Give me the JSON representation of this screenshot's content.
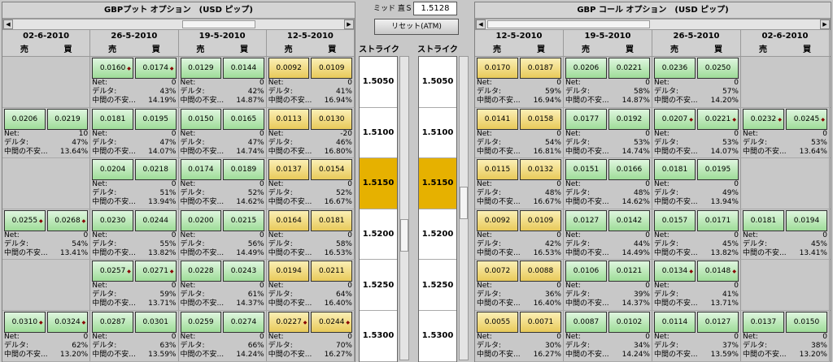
{
  "put": {
    "title": "GBPプット オプション　(USD ピップ)",
    "dates": [
      "02-6-2010",
      "26-5-2010",
      "19-5-2010",
      "12-5-2010"
    ],
    "headers": {
      "sell": "売",
      "buy": "買"
    },
    "rows": [
      [
        null,
        {
          "bid": "0.0160",
          "ask": "0.0174",
          "net": "0",
          "delta": "43%",
          "iv": "14.19%",
          "color": "green",
          "marks": true
        },
        {
          "bid": "0.0129",
          "ask": "0.0144",
          "net": "0",
          "delta": "42%",
          "iv": "14.87%",
          "color": "green"
        },
        {
          "bid": "0.0092",
          "ask": "0.0109",
          "net": "0",
          "delta": "41%",
          "iv": "16.94%",
          "color": "yellow"
        }
      ],
      [
        {
          "bid": "0.0206",
          "ask": "0.0219",
          "net": "10",
          "delta": "47%",
          "iv": "13.64%",
          "color": "green"
        },
        {
          "bid": "0.0181",
          "ask": "0.0195",
          "net": "0",
          "delta": "47%",
          "iv": "14.07%",
          "color": "green"
        },
        {
          "bid": "0.0150",
          "ask": "0.0165",
          "net": "0",
          "delta": "47%",
          "iv": "14.74%",
          "color": "green"
        },
        {
          "bid": "0.0113",
          "ask": "0.0130",
          "net": "-20",
          "delta": "46%",
          "iv": "16.80%",
          "color": "yellow"
        }
      ],
      [
        null,
        {
          "bid": "0.0204",
          "ask": "0.0218",
          "net": "0",
          "delta": "51%",
          "iv": "13.94%",
          "color": "green"
        },
        {
          "bid": "0.0174",
          "ask": "0.0189",
          "net": "0",
          "delta": "52%",
          "iv": "14.62%",
          "color": "green"
        },
        {
          "bid": "0.0137",
          "ask": "0.0154",
          "net": "0",
          "delta": "52%",
          "iv": "16.67%",
          "color": "yellow"
        }
      ],
      [
        {
          "bid": "0.0255",
          "ask": "0.0268",
          "net": "0",
          "delta": "54%",
          "iv": "13.41%",
          "color": "green",
          "marks": true
        },
        {
          "bid": "0.0230",
          "ask": "0.0244",
          "net": "0",
          "delta": "55%",
          "iv": "13.82%",
          "color": "green"
        },
        {
          "bid": "0.0200",
          "ask": "0.0215",
          "net": "0",
          "delta": "56%",
          "iv": "14.49%",
          "color": "green"
        },
        {
          "bid": "0.0164",
          "ask": "0.0181",
          "net": "0",
          "delta": "58%",
          "iv": "16.53%",
          "color": "yellow"
        }
      ],
      [
        null,
        {
          "bid": "0.0257",
          "ask": "0.0271",
          "net": "0",
          "delta": "59%",
          "iv": "13.71%",
          "color": "green",
          "marks": true
        },
        {
          "bid": "0.0228",
          "ask": "0.0243",
          "net": "0",
          "delta": "61%",
          "iv": "14.37%",
          "color": "green"
        },
        {
          "bid": "0.0194",
          "ask": "0.0211",
          "net": "0",
          "delta": "64%",
          "iv": "16.40%",
          "color": "yellow"
        }
      ],
      [
        {
          "bid": "0.0310",
          "ask": "0.0324",
          "net": "0",
          "delta": "62%",
          "iv": "13.20%",
          "color": "green",
          "marks": true
        },
        {
          "bid": "0.0287",
          "ask": "0.0301",
          "net": "0",
          "delta": "63%",
          "iv": "13.59%",
          "color": "green"
        },
        {
          "bid": "0.0259",
          "ask": "0.0274",
          "net": "0",
          "delta": "66%",
          "iv": "14.24%",
          "color": "green"
        },
        {
          "bid": "0.0227",
          "ask": "0.0244",
          "net": "0",
          "delta": "70%",
          "iv": "16.27%",
          "color": "yellow",
          "marks": true
        }
      ]
    ]
  },
  "call": {
    "title": "GBP コール オプション　(USD ピップ)",
    "dates": [
      "12-5-2010",
      "19-5-2010",
      "26-5-2010",
      "02-6-2010"
    ],
    "rows": [
      [
        {
          "bid": "0.0170",
          "ask": "0.0187",
          "net": "0",
          "delta": "59%",
          "iv": "16.94%",
          "color": "yellow"
        },
        {
          "bid": "0.0206",
          "ask": "0.0221",
          "net": "0",
          "delta": "58%",
          "iv": "14.87%",
          "color": "green"
        },
        {
          "bid": "0.0236",
          "ask": "0.0250",
          "net": "0",
          "delta": "57%",
          "iv": "14.20%",
          "color": "green"
        },
        null
      ],
      [
        {
          "bid": "0.0141",
          "ask": "0.0158",
          "net": "0",
          "delta": "54%",
          "iv": "16.81%",
          "color": "yellow"
        },
        {
          "bid": "0.0177",
          "ask": "0.0192",
          "net": "0",
          "delta": "53%",
          "iv": "14.74%",
          "color": "green"
        },
        {
          "bid": "0.0207",
          "ask": "0.0221",
          "net": "0",
          "delta": "53%",
          "iv": "14.07%",
          "color": "green",
          "marks": true
        },
        {
          "bid": "0.0232",
          "ask": "0.0245",
          "net": "0",
          "delta": "53%",
          "iv": "13.64%",
          "color": "green",
          "marks": true
        }
      ],
      [
        {
          "bid": "0.0115",
          "ask": "0.0132",
          "net": "0",
          "delta": "48%",
          "iv": "16.67%",
          "color": "yellow"
        },
        {
          "bid": "0.0151",
          "ask": "0.0166",
          "net": "0",
          "delta": "48%",
          "iv": "14.62%",
          "color": "green"
        },
        {
          "bid": "0.0181",
          "ask": "0.0195",
          "net": "0",
          "delta": "49%",
          "iv": "13.94%",
          "color": "green"
        },
        null
      ],
      [
        {
          "bid": "0.0092",
          "ask": "0.0109",
          "net": "0",
          "delta": "42%",
          "iv": "16.53%",
          "color": "yellow"
        },
        {
          "bid": "0.0127",
          "ask": "0.0142",
          "net": "0",
          "delta": "44%",
          "iv": "14.49%",
          "color": "green"
        },
        {
          "bid": "0.0157",
          "ask": "0.0171",
          "net": "0",
          "delta": "45%",
          "iv": "13.82%",
          "color": "green"
        },
        {
          "bid": "0.0181",
          "ask": "0.0194",
          "net": "0",
          "delta": "45%",
          "iv": "13.41%",
          "color": "green"
        }
      ],
      [
        {
          "bid": "0.0072",
          "ask": "0.0088",
          "net": "0",
          "delta": "36%",
          "iv": "16.40%",
          "color": "yellow"
        },
        {
          "bid": "0.0106",
          "ask": "0.0121",
          "net": "0",
          "delta": "39%",
          "iv": "14.37%",
          "color": "green"
        },
        {
          "bid": "0.0134",
          "ask": "0.0148",
          "net": "0",
          "delta": "41%",
          "iv": "13.71%",
          "color": "green",
          "marks": true
        },
        null
      ],
      [
        {
          "bid": "0.0055",
          "ask": "0.0071",
          "net": "0",
          "delta": "30%",
          "iv": "16.27%",
          "color": "yellow"
        },
        {
          "bid": "0.0087",
          "ask": "0.0102",
          "net": "0",
          "delta": "34%",
          "iv": "14.24%",
          "color": "green"
        },
        {
          "bid": "0.0114",
          "ask": "0.0127",
          "net": "0",
          "delta": "37%",
          "iv": "13.59%",
          "color": "green"
        },
        {
          "bid": "0.0137",
          "ask": "0.0150",
          "net": "0",
          "delta": "38%",
          "iv": "13.20%",
          "color": "green"
        }
      ]
    ]
  },
  "labels": {
    "net": "Net:",
    "delta": "デルタ:",
    "iv": "中間の不安...",
    "strike": "ストライク",
    "mid_label": "ミッド 直Ｓ",
    "mid_value": "1.5128",
    "reset": "リセット(ATM)"
  },
  "strikes": [
    "1.5050",
    "1.5100",
    "1.5150",
    "1.5200",
    "1.5250",
    "1.5300"
  ],
  "atm_index": 2,
  "colors": {
    "green": "#a8e0a0",
    "yellow": "#efd36c",
    "atm": "#e6b100"
  }
}
